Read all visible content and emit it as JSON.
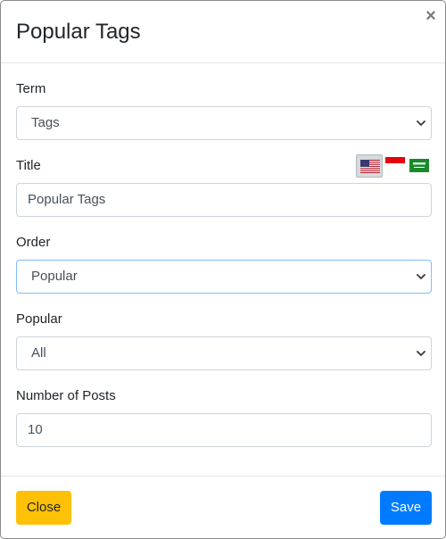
{
  "modal": {
    "title": "Popular Tags",
    "close_glyph": "×"
  },
  "form": {
    "term": {
      "label": "Term",
      "value": "Tags"
    },
    "title": {
      "label": "Title",
      "value": "Popular Tags"
    },
    "order": {
      "label": "Order",
      "value": "Popular"
    },
    "popular": {
      "label": "Popular",
      "value": "All"
    },
    "number_of_posts": {
      "label": "Number of Posts",
      "value": "10"
    }
  },
  "languages": [
    {
      "icon": "us-flag-icon",
      "active": true
    },
    {
      "icon": "indonesia-flag-icon",
      "active": false
    },
    {
      "icon": "saudi-arabia-flag-icon",
      "active": false
    }
  ],
  "footer": {
    "close_label": "Close",
    "save_label": "Save"
  },
  "colors": {
    "close_button": "#ffc107",
    "save_button": "#007bff",
    "focus_border": "#80bdff"
  }
}
